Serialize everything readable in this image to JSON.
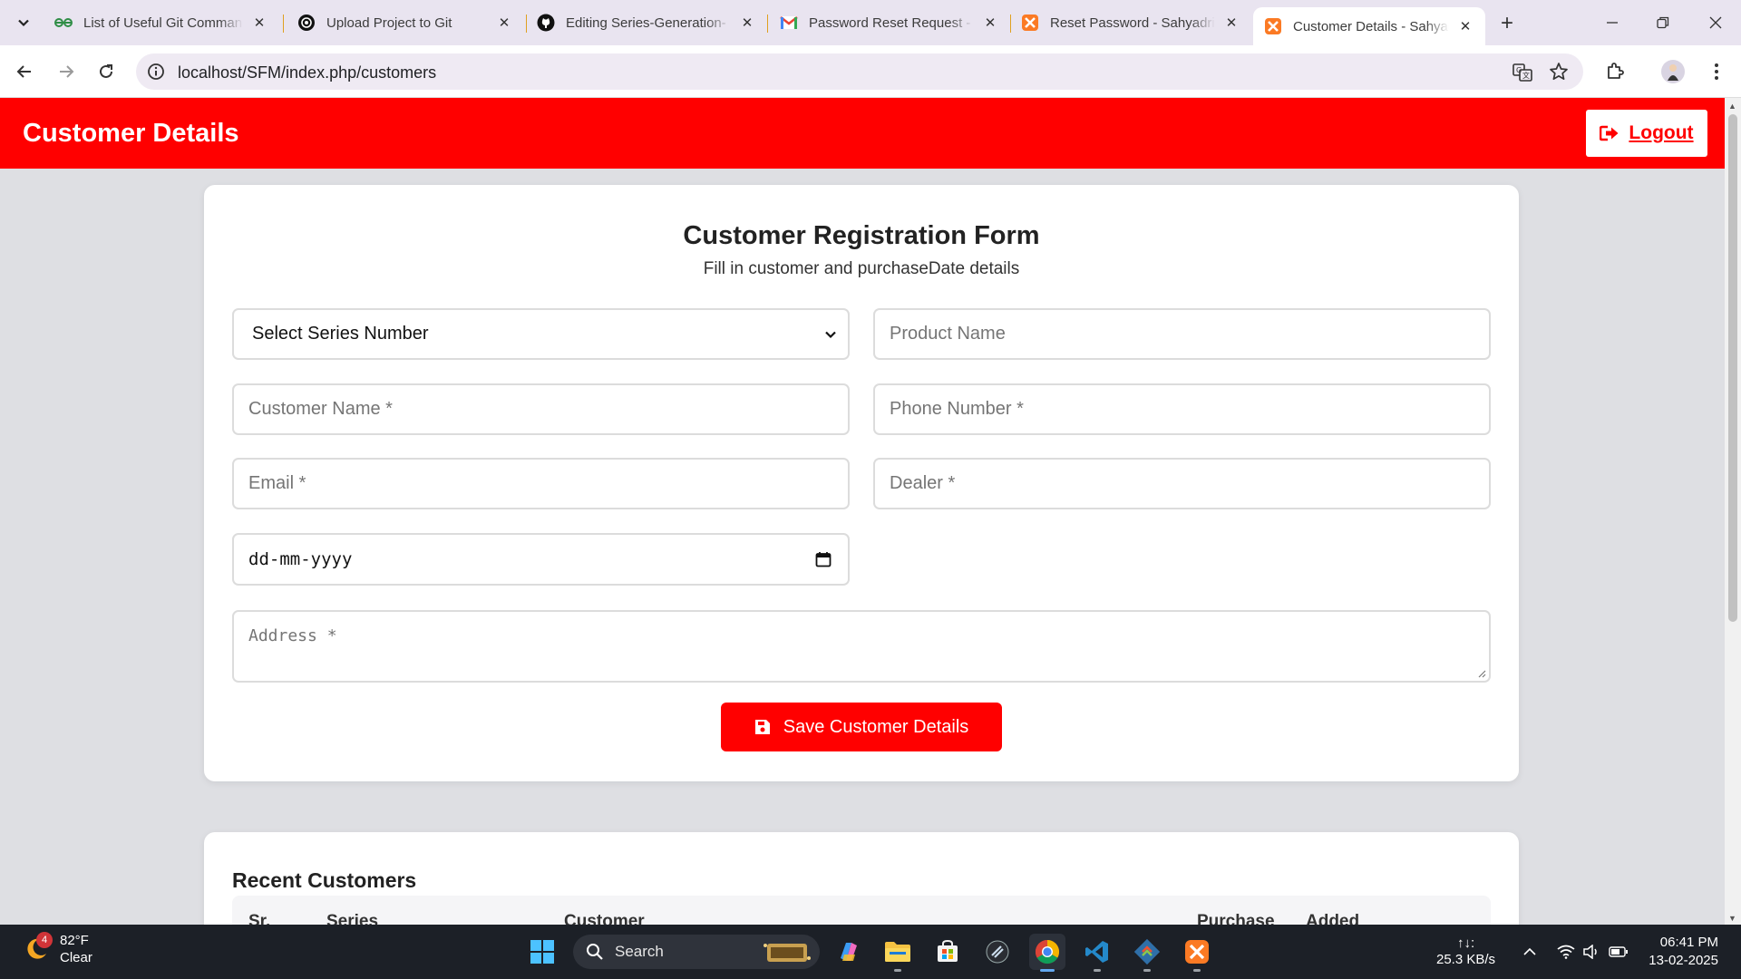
{
  "browser": {
    "tabs": [
      {
        "title": "List of Useful Git Commands",
        "favicon": "geeksforgeeks-icon"
      },
      {
        "title": "Upload Project to Git",
        "favicon": "chatgpt-icon"
      },
      {
        "title": "Editing Series-Generation-",
        "favicon": "github-icon"
      },
      {
        "title": "Password Reset Request - ",
        "favicon": "gmail-icon"
      },
      {
        "title": "Reset Password - Sahyadri",
        "favicon": "xampp-icon"
      },
      {
        "title": "Customer Details - Sahyadri",
        "favicon": "xampp-icon",
        "active": true
      }
    ],
    "url": "localhost/SFM/index.php/customers"
  },
  "app": {
    "title": "Customer Details",
    "logout_label": "Logout",
    "brand_color": "#ff0000"
  },
  "form": {
    "title": "Customer Registration Form",
    "subtitle": "Fill in customer and purchaseDate details",
    "series_select": "Select Series Number",
    "product_name_placeholder": "Product Name",
    "customer_name_placeholder": "Customer Name *",
    "phone_placeholder": "Phone Number *",
    "email_placeholder": "Email *",
    "dealer_placeholder": "Dealer *",
    "date_placeholder": "dd-mm-yyyy",
    "address_placeholder": "Address *",
    "save_label": "Save Customer Details"
  },
  "recent": {
    "title": "Recent Customers",
    "columns": [
      "Sr.",
      "Series",
      "Customer",
      "Purchase",
      "Added"
    ]
  },
  "taskbar": {
    "weather_temp": "82°F",
    "weather_cond": "Clear",
    "weather_badge": "4",
    "search_label": "Search",
    "net_arrows": "↑↓:",
    "net_speed": "25.3 KB/s",
    "time": "06:41 PM",
    "date": "13-02-2025"
  }
}
